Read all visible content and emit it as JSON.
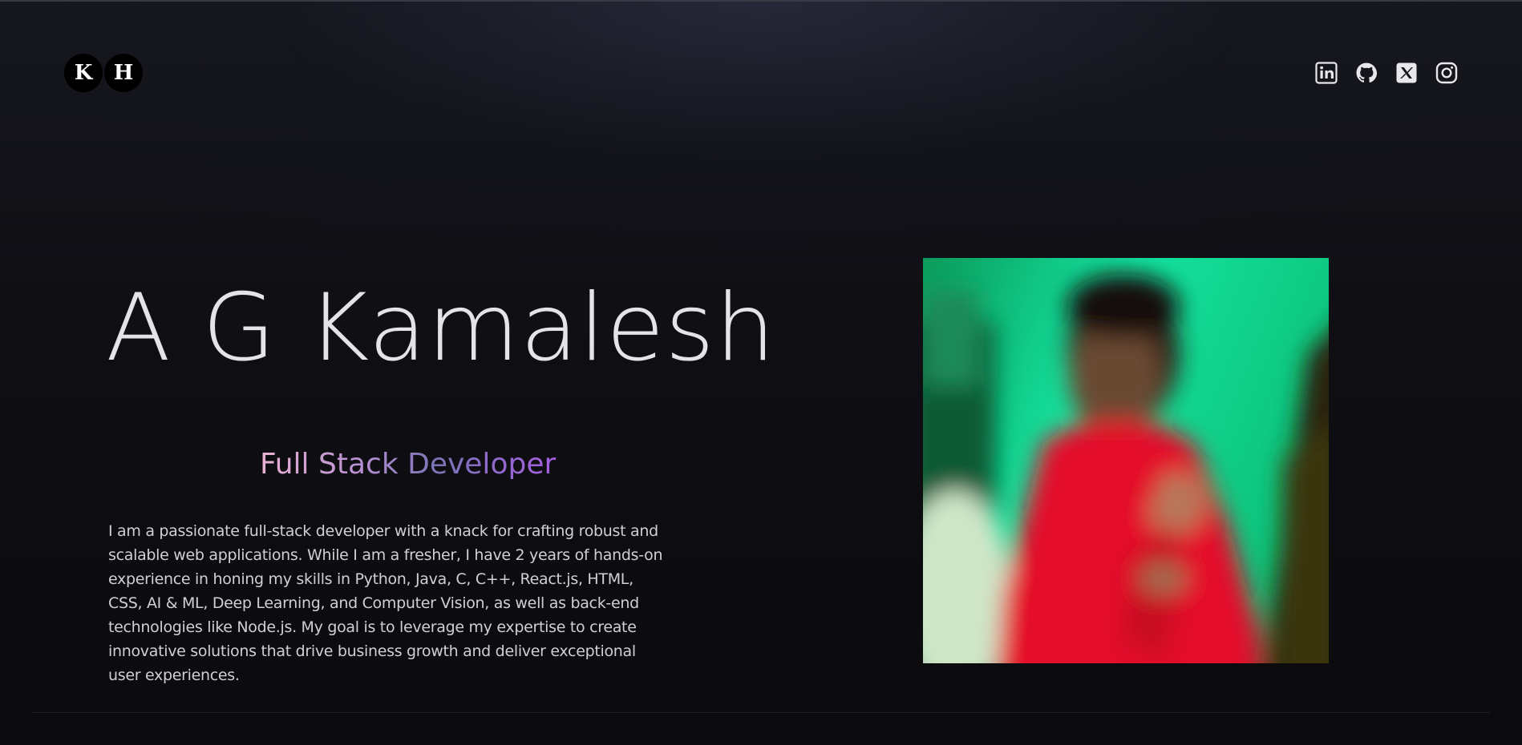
{
  "header": {
    "logo_letters": [
      "K",
      "H"
    ],
    "socials": [
      {
        "icon": "linkedin-icon",
        "label": "LinkedIn"
      },
      {
        "icon": "github-icon",
        "label": "GitHub"
      },
      {
        "icon": "x-twitter-icon",
        "label": "X"
      },
      {
        "icon": "instagram-icon",
        "label": "Instagram"
      }
    ]
  },
  "hero": {
    "name": "A G Kamalesh",
    "role": "Full Stack Developer",
    "description": "I am a passionate full-stack developer with a knack for crafting robust and scalable web applications. While I am a fresher, I have 2 years of hands-on experience in honing my skills in Python, Java, C, C++, React.js, HTML, CSS, AI & ML, Deep Learning, and Computer Vision, as well as back-end technologies like Node.js. My goal is to leverage my expertise to create innovative solutions that drive business growth and deliver exceptional user experiences.",
    "portrait": "blurred-portrait-photo"
  },
  "colors": {
    "background": "#0b0b0e",
    "text": "#e4e4e8",
    "role_gradient_start": "#e9b2d4",
    "role_gradient_end": "#a55fe0",
    "icon": "#e8e8ec"
  }
}
